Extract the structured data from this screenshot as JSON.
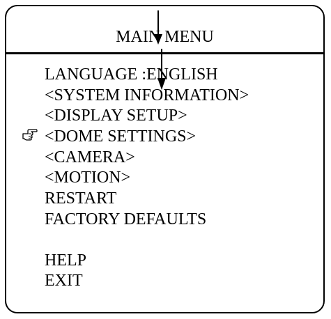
{
  "menu": {
    "title": "MAIN MENU",
    "items": [
      {
        "label": "LANGUAGE :ENGLISH"
      },
      {
        "label": "<SYSTEM INFORMATION>"
      },
      {
        "label": "<DISPLAY SETUP>"
      },
      {
        "label": "<DOME SETTINGS>"
      },
      {
        "label": "<CAMERA>"
      },
      {
        "label": "<MOTION>"
      },
      {
        "label": "RESTART"
      },
      {
        "label": "FACTORY DEFAULTS"
      },
      {
        "label": "HELP"
      },
      {
        "label": "EXIT"
      }
    ],
    "selected_index": 3
  },
  "icons": {
    "pointer": "pointing-hand-icon",
    "arrow": "down-arrow-icon"
  },
  "colors": {
    "foreground": "#000000",
    "background": "#ffffff"
  }
}
